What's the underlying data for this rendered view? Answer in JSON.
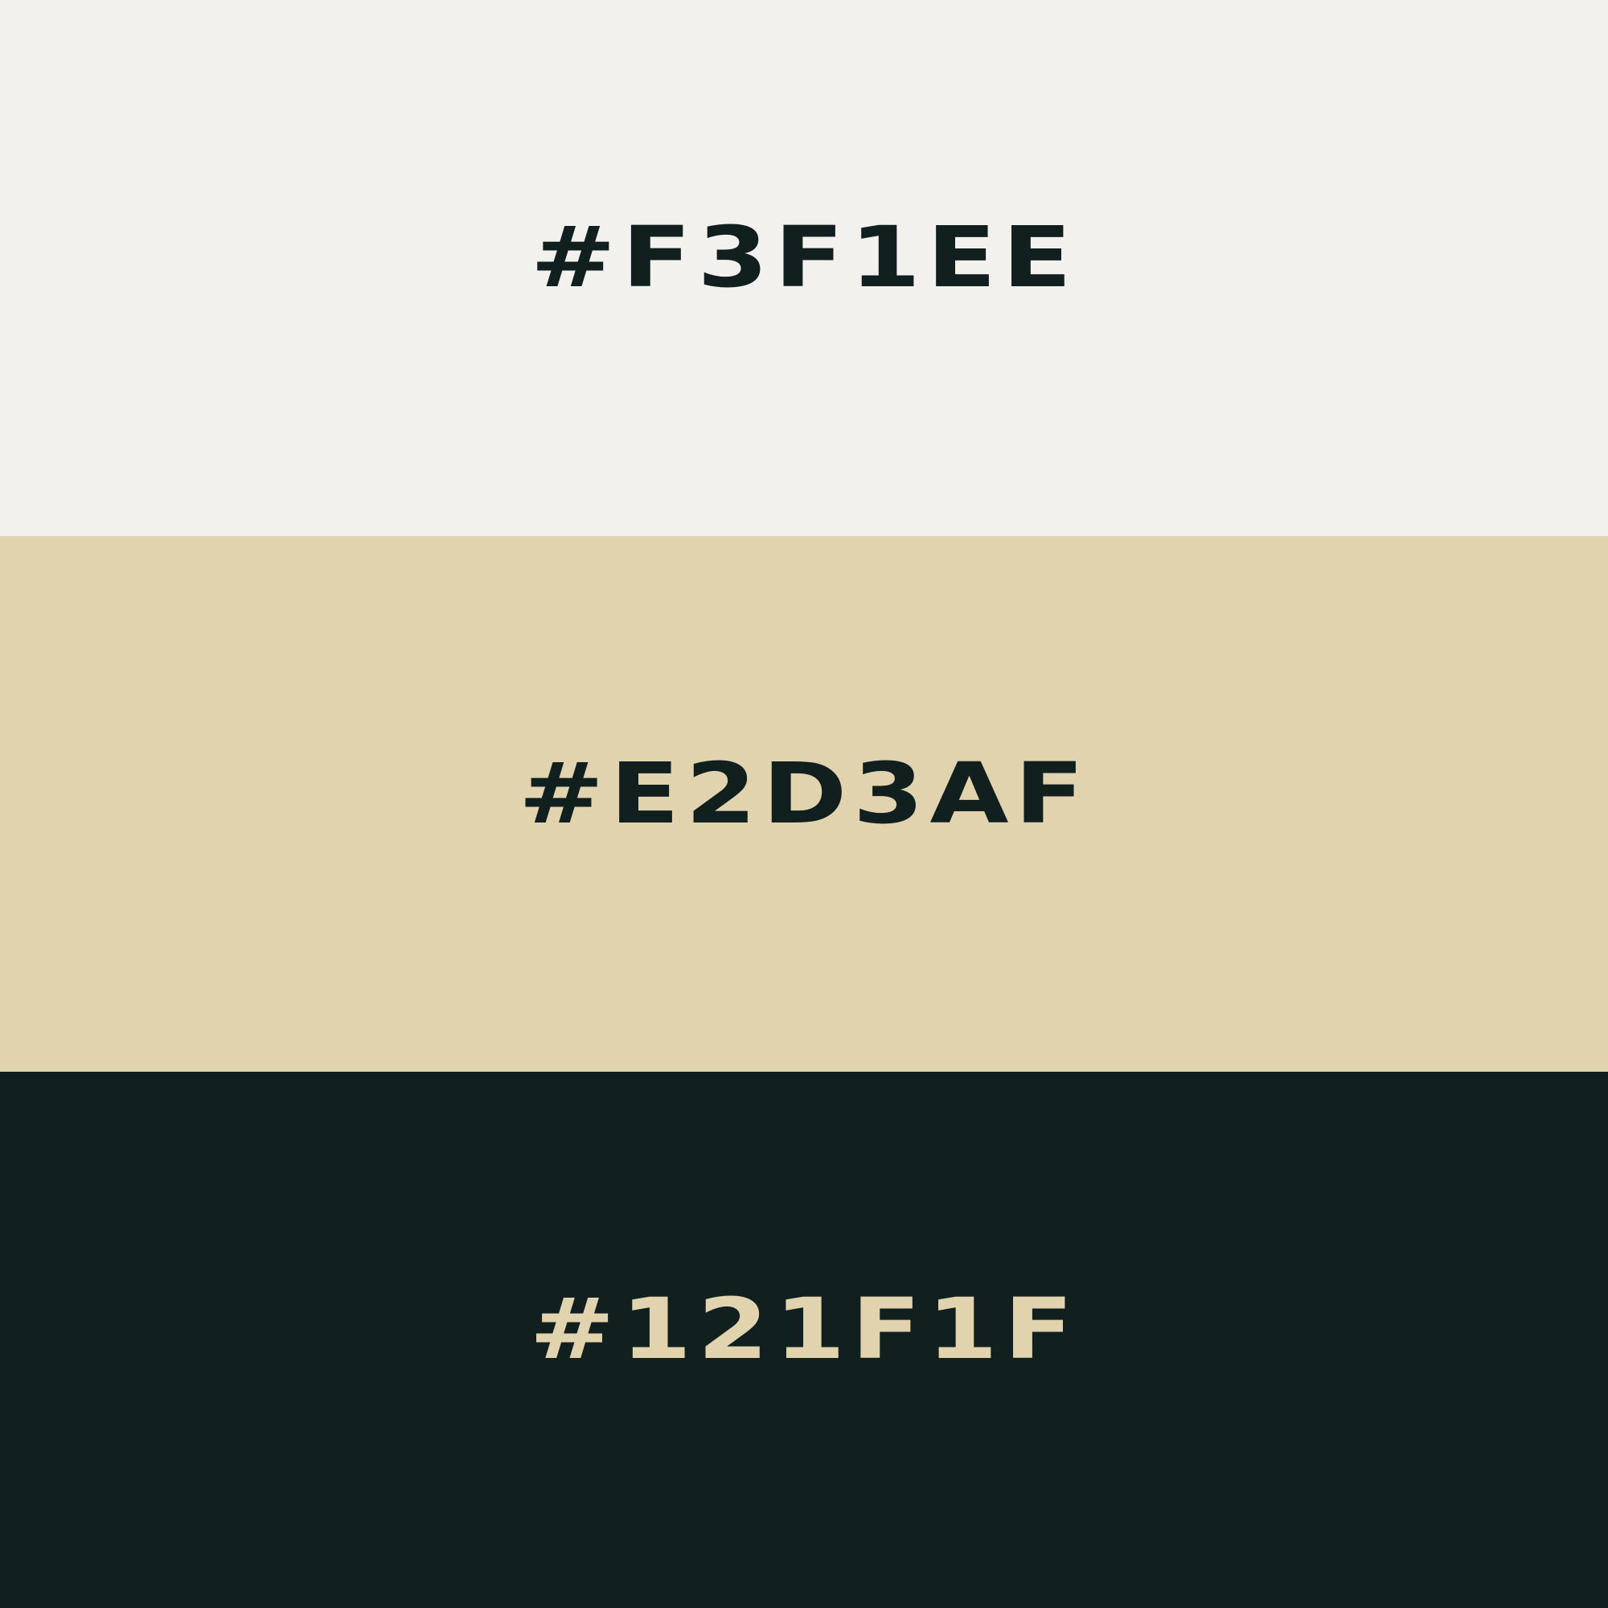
{
  "swatches": [
    {
      "label": "#F3F1EE",
      "background": "#F3F1EE",
      "text_color": "#121F1F"
    },
    {
      "label": "#E2D3AF",
      "background": "#E2D3AF",
      "text_color": "#121F1F"
    },
    {
      "label": "#121F1F",
      "background": "#121F1F",
      "text_color": "#E2D3AF"
    }
  ]
}
